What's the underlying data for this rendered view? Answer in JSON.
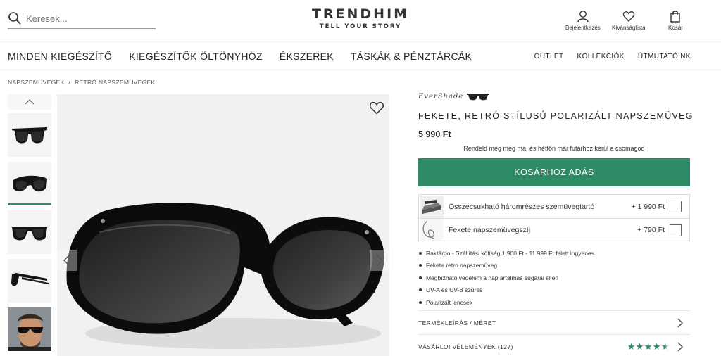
{
  "header": {
    "search_placeholder": "Keresek...",
    "logo_main": "TRENDHIM",
    "logo_sub": "TELL YOUR STORY",
    "actions": [
      {
        "label": "Bejelentkezés",
        "icon": "user-icon"
      },
      {
        "label": "Kívánságlista",
        "icon": "heart-icon"
      },
      {
        "label": "Kosár",
        "icon": "shopping-bag-icon"
      }
    ]
  },
  "nav": {
    "main": [
      "MINDEN KIEGÉSZÍTŐ",
      "KIEGÉSZÍTŐK ÖLTÖNYHÖZ",
      "ÉKSZEREK",
      "TÁSKÁK & PÉNZTÁRCÁK"
    ],
    "right": [
      "OUTLET",
      "KOLLEKCIÓK",
      "ÚTMUTATÓINK"
    ]
  },
  "breadcrumb": {
    "items": [
      "NAPSZEMÜVEGEK",
      "RETRÓ NAPSZEMÜVEGEK"
    ],
    "separator": "/"
  },
  "gallery": {
    "thumbnails": [
      "sunglasses-front-thumb",
      "sunglasses-angle-thumb",
      "sunglasses-top-thumb",
      "sunglasses-side-thumb",
      "model-wearing-thumb"
    ],
    "active_index": 1
  },
  "product": {
    "brand": "EverShade",
    "title": "FEKETE, RETRÓ STÍLUSÚ POLARIZÁLT NAPSZEMÜVEG",
    "price": "5 990 Ft",
    "shipping_note": "Rendeld meg még ma, és hétfőn már futárhoz kerül a csomagod",
    "cart_button": "KOSÁRHOZ ADÁS",
    "accent_color": "#2e8b66",
    "addons": [
      {
        "name": "Összecsukható háromrészes szemüvegtartó",
        "price": "+ 1 990 Ft",
        "checked": false
      },
      {
        "name": "Fekete napszemüvegszíj",
        "price": "+ 790 Ft",
        "checked": false
      }
    ],
    "features": [
      "Raktáron - Szállítási költség 1 900 Ft - 11 999 Ft felett ingyenes",
      "Fekete retro napszemüveg",
      "Megbízható védelem a nap ártalmas sugarai ellen",
      "UV-A és UV-B szűrés",
      "Polarizált lencsék"
    ],
    "accordions": [
      {
        "label": "TERMÉKLEÍRÁS / MÉRET"
      },
      {
        "label": "VÁSÁRLÓI VÉLEMÉNYEK (127)",
        "rating": 4.5
      }
    ]
  }
}
